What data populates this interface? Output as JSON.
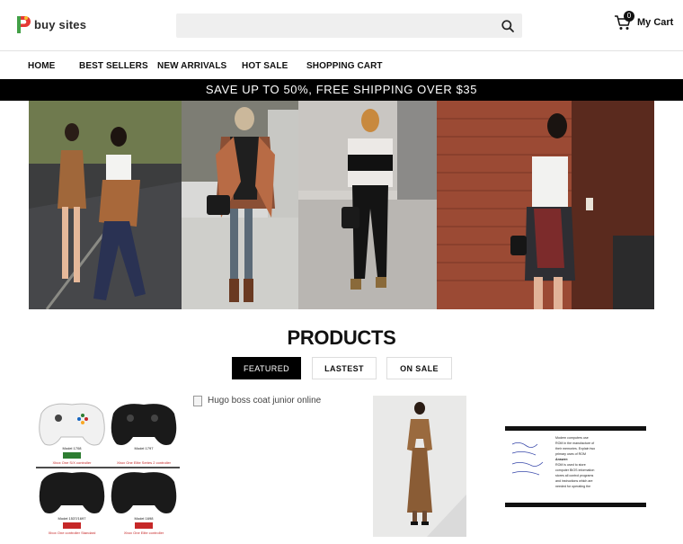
{
  "brand": {
    "name": "buy sites"
  },
  "search": {
    "placeholder": "",
    "value": ""
  },
  "cart": {
    "count": "0",
    "label": "My Cart"
  },
  "nav": [
    "HOME",
    "BEST SELLERS",
    "NEW ARRIVALS",
    "HOT SALE",
    "SHOPPING CART"
  ],
  "promo": "SAVE UP TO 50%, FREE SHIPPING OVER $35",
  "products": {
    "title": "PRODUCTS",
    "tabs": [
      "FEATURED",
      "LASTEST",
      "ON SALE"
    ],
    "items": [
      {
        "labels": [
          "Model 1708",
          "Model 1797",
          "Xbox One S/X controller",
          "Xbox One Elite Series 2 controller",
          "Model 1537/1697",
          "Model 1698",
          "Xbox One controller Standard",
          "Xbox One Elite controller"
        ]
      },
      {
        "alt": "Hugo boss coat junior online"
      },
      {
        "type": "dress-photo"
      },
      {
        "note_lines": [
          "Modern computers use",
          "ROM in the manufacture of",
          "their memories. Explain two",
          "primary uses of ROM",
          "Answer:",
          "ROM is used to store",
          "computer BIOS information",
          "stores all control programs",
          "and instructions which are",
          "needed for operating the"
        ]
      }
    ]
  },
  "colors": {
    "black": "#000000",
    "logo_red": "#e53935",
    "logo_green": "#43a047",
    "search_bg": "#efefef"
  }
}
